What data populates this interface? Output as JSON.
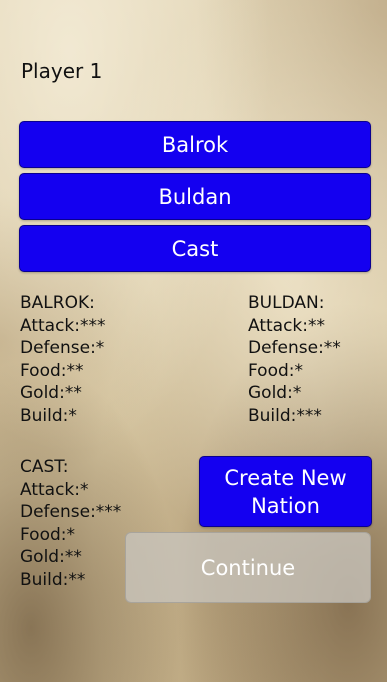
{
  "header": {
    "player_label": "Player 1"
  },
  "nation_buttons": [
    {
      "label": "Balrok"
    },
    {
      "label": "Buldan"
    },
    {
      "label": "Cast"
    }
  ],
  "nations": {
    "balrok": {
      "title": "BALROK:",
      "stats": [
        "Attack:***",
        "Defense:*",
        "Food:**",
        "Gold:**",
        "Build:*"
      ]
    },
    "buldan": {
      "title": "BULDAN:",
      "stats": [
        "Attack:**",
        "Defense:**",
        "Food:*",
        "Gold:*",
        "Build:***"
      ]
    },
    "cast": {
      "title": "CAST:",
      "stats": [
        "Attack:*",
        "Defense:***",
        "Food:*",
        "Gold:**",
        "Build:**"
      ]
    }
  },
  "actions": {
    "create_line1": "Create New",
    "create_line2": "Nation",
    "continue_label": "Continue"
  },
  "colors": {
    "button_blue": "#1400f0",
    "disabled_gray": "#c8c4bc"
  }
}
